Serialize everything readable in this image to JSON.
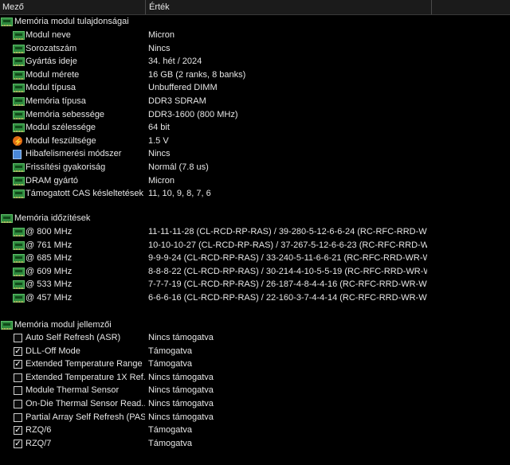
{
  "header": {
    "field": "Mező",
    "value": "Érték"
  },
  "sections": {
    "props": {
      "title": "Memória modul tulajdonságai",
      "rows": [
        {
          "label": "Modul neve",
          "value": "Micron"
        },
        {
          "label": "Sorozatszám",
          "value": "Nincs"
        },
        {
          "label": "Gyártás ideje",
          "value": "34. hét / 2024"
        },
        {
          "label": "Modul mérete",
          "value": "16 GB (2 ranks, 8 banks)"
        },
        {
          "label": "Modul típusa",
          "value": "Unbuffered DIMM"
        },
        {
          "label": "Memória típusa",
          "value": "DDR3 SDRAM"
        },
        {
          "label": "Memória sebessége",
          "value": "DDR3-1600 (800 MHz)"
        },
        {
          "label": "Modul szélessége",
          "value": "64 bit"
        },
        {
          "label": "Modul feszültsége",
          "value": "1.5 V"
        },
        {
          "label": "Hibafelismerési módszer",
          "value": "Nincs"
        },
        {
          "label": "Frissítési gyakoriság",
          "value": "Normál (7.8 us)"
        },
        {
          "label": "DRAM gyártó",
          "value": "Micron"
        },
        {
          "label": "Támogatott CAS késleltetések",
          "value": "11, 10, 9, 8, 7, 6"
        }
      ]
    },
    "timings": {
      "title": "Memória időzítések",
      "rows": [
        {
          "label": "@ 800 MHz",
          "value": "11-11-11-28  (CL-RCD-RP-RAS) / 39-280-5-12-6-6-24  (RC-RFC-RRD-WR-"
        },
        {
          "label": "@ 761 MHz",
          "value": "10-10-10-27  (CL-RCD-RP-RAS) / 37-267-5-12-6-6-23  (RC-RFC-RRD-WR-"
        },
        {
          "label": "@ 685 MHz",
          "value": "9-9-9-24  (CL-RCD-RP-RAS) / 33-240-5-11-6-6-21  (RC-RFC-RRD-WR-WT"
        },
        {
          "label": "@ 609 MHz",
          "value": "8-8-8-22  (CL-RCD-RP-RAS) / 30-214-4-10-5-5-19  (RC-RFC-RRD-WR-WT"
        },
        {
          "label": "@ 533 MHz",
          "value": "7-7-7-19  (CL-RCD-RP-RAS) / 26-187-4-8-4-4-16  (RC-RFC-RRD-WR-WTR"
        },
        {
          "label": "@ 457 MHz",
          "value": "6-6-6-16  (CL-RCD-RP-RAS) / 22-160-3-7-4-4-14  (RC-RFC-RRD-WR-WTR"
        }
      ]
    },
    "features": {
      "title": "Memória modul jellemzői",
      "check_glyph": "✓",
      "rows": [
        {
          "label": "Auto Self Refresh (ASR)",
          "value": "Nincs támogatva",
          "checked": false
        },
        {
          "label": "DLL-Off Mode",
          "value": "Támogatva",
          "checked": true
        },
        {
          "label": "Extended Temperature Range",
          "value": "Támogatva",
          "checked": true
        },
        {
          "label": "Extended Temperature 1X Ref...",
          "value": "Nincs támogatva",
          "checked": false
        },
        {
          "label": "Module Thermal Sensor",
          "value": "Nincs támogatva",
          "checked": false
        },
        {
          "label": "On-Die Thermal Sensor Read...",
          "value": "Nincs támogatva",
          "checked": false
        },
        {
          "label": "Partial Array Self Refresh (PASR)",
          "value": "Nincs támogatva",
          "checked": false
        },
        {
          "label": "RZQ/6",
          "value": "Támogatva",
          "checked": true
        },
        {
          "label": "RZQ/7",
          "value": "Támogatva",
          "checked": true
        }
      ]
    }
  }
}
